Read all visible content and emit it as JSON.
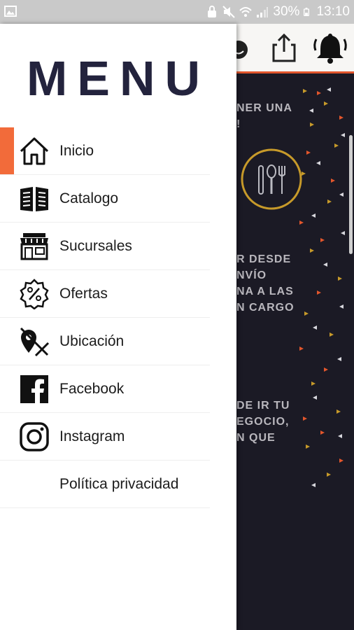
{
  "status_bar": {
    "battery": "30%",
    "time": "13:10"
  },
  "drawer": {
    "title": "MENU",
    "items": [
      {
        "label": "Inicio",
        "icon": "home-icon",
        "active": true
      },
      {
        "label": "Catalogo",
        "icon": "catalog-book-icon",
        "active": false
      },
      {
        "label": "Sucursales",
        "icon": "store-icon",
        "active": false
      },
      {
        "label": "Ofertas",
        "icon": "percent-badge-icon",
        "active": false
      },
      {
        "label": "Ubicación",
        "icon": "location-off-icon",
        "active": false
      },
      {
        "label": "Facebook",
        "icon": "facebook-icon",
        "active": false
      },
      {
        "label": "Instagram",
        "icon": "instagram-icon",
        "active": false
      },
      {
        "label": "Política privacidad",
        "icon": "",
        "active": false
      }
    ]
  },
  "background": {
    "text_block_1": "NER UNA\n!",
    "text_block_2": "R DESDE\nNVÍO\nNA A LAS\nN CARGO",
    "text_block_3": "DE IR TU\nEGOCIO,\nN QUE"
  },
  "colors": {
    "accent": "#f26b3a",
    "title": "#23233d",
    "dark_bg": "#1b1a25",
    "gold": "#c79a2a"
  }
}
